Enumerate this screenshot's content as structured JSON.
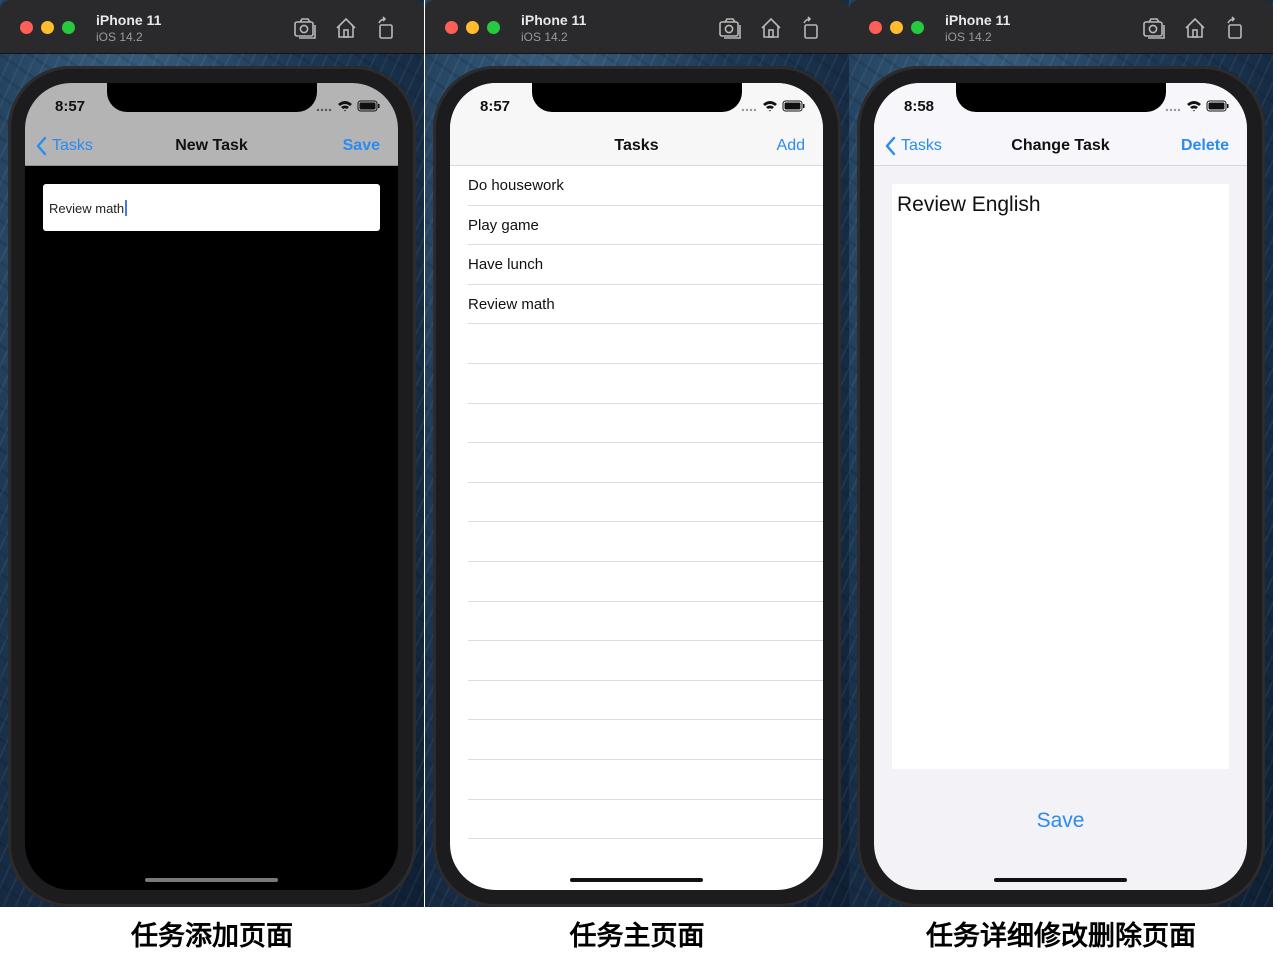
{
  "simulators": [
    {
      "device_name": "iPhone 11",
      "os_version": "iOS 14.2",
      "status_time": "8:57",
      "nav": {
        "back_label": "Tasks",
        "title": "New Task",
        "right_label": "Save"
      },
      "input_value": "Review math",
      "caption": "任务添加页面"
    },
    {
      "device_name": "iPhone 11",
      "os_version": "iOS 14.2",
      "status_time": "8:57",
      "nav": {
        "title": "Tasks",
        "right_label": "Add"
      },
      "tasks": [
        "Do housework",
        "Play game",
        "Have lunch",
        "Review math"
      ],
      "caption": "任务主页面"
    },
    {
      "device_name": "iPhone 11",
      "os_version": "iOS 14.2",
      "status_time": "8:58",
      "nav": {
        "back_label": "Tasks",
        "title": "Change Task",
        "right_label": "Delete"
      },
      "text_value": "Review English",
      "save_label": "Save",
      "caption": "任务详细修改删除页面"
    }
  ],
  "colors": {
    "accent": "#2a8bf2",
    "titlebar": "#2a2a2c"
  },
  "icons": [
    "screenshot-icon",
    "home-icon",
    "rotate-icon",
    "wifi-icon",
    "battery-icon",
    "signal-icon",
    "chevron-left-icon"
  ]
}
